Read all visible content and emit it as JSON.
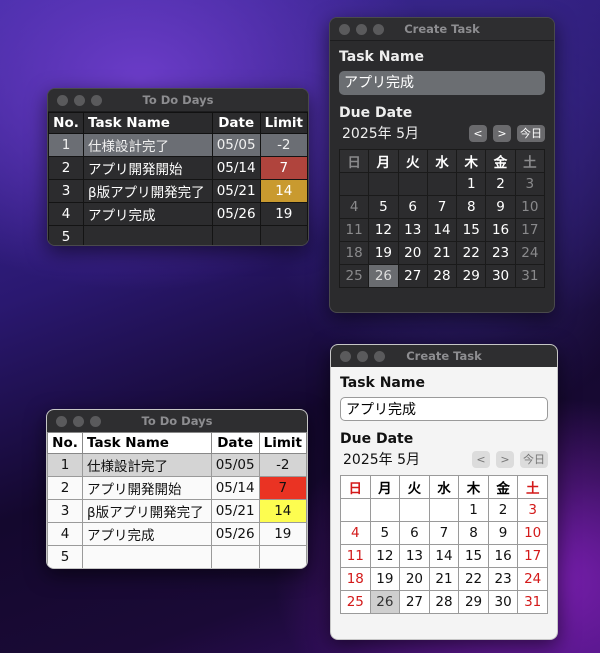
{
  "todo": {
    "title": "To Do Days",
    "headers": {
      "no": "No.",
      "name": "Task Name",
      "date": "Date",
      "limit": "Limit"
    },
    "rows": [
      {
        "no": "1",
        "name": "仕様設計完了",
        "date": "05/05",
        "limit": "-2"
      },
      {
        "no": "2",
        "name": "アプリ開発開始",
        "date": "05/14",
        "limit": "7"
      },
      {
        "no": "3",
        "name": "β版アプリ開発完了",
        "date": "05/21",
        "limit": "14"
      },
      {
        "no": "4",
        "name": "アプリ完成",
        "date": "05/26",
        "limit": "19"
      },
      {
        "no": "5",
        "name": "",
        "date": "",
        "limit": ""
      }
    ]
  },
  "create": {
    "title": "Create Task",
    "task_label": "Task Name",
    "task_value": "アプリ完成",
    "due_label": "Due Date",
    "month": "2025年 5月",
    "prev": "<",
    "next": ">",
    "today": "今日",
    "weekdays": [
      "日",
      "月",
      "火",
      "水",
      "木",
      "金",
      "土"
    ],
    "weeks": [
      [
        "",
        "",
        "",
        "",
        "1",
        "2",
        "3"
      ],
      [
        "4",
        "5",
        "6",
        "7",
        "8",
        "9",
        "10"
      ],
      [
        "11",
        "12",
        "13",
        "14",
        "15",
        "16",
        "17"
      ],
      [
        "18",
        "19",
        "20",
        "21",
        "22",
        "23",
        "24"
      ],
      [
        "25",
        "26",
        "27",
        "28",
        "29",
        "30",
        "31"
      ]
    ],
    "selected_day": "26"
  },
  "colors": {
    "limit_red_dark": "#b0443d",
    "limit_amber_dark": "#c99a2f",
    "limit_red_light": "#ea3323",
    "limit_yellow_light": "#fdfd50"
  }
}
